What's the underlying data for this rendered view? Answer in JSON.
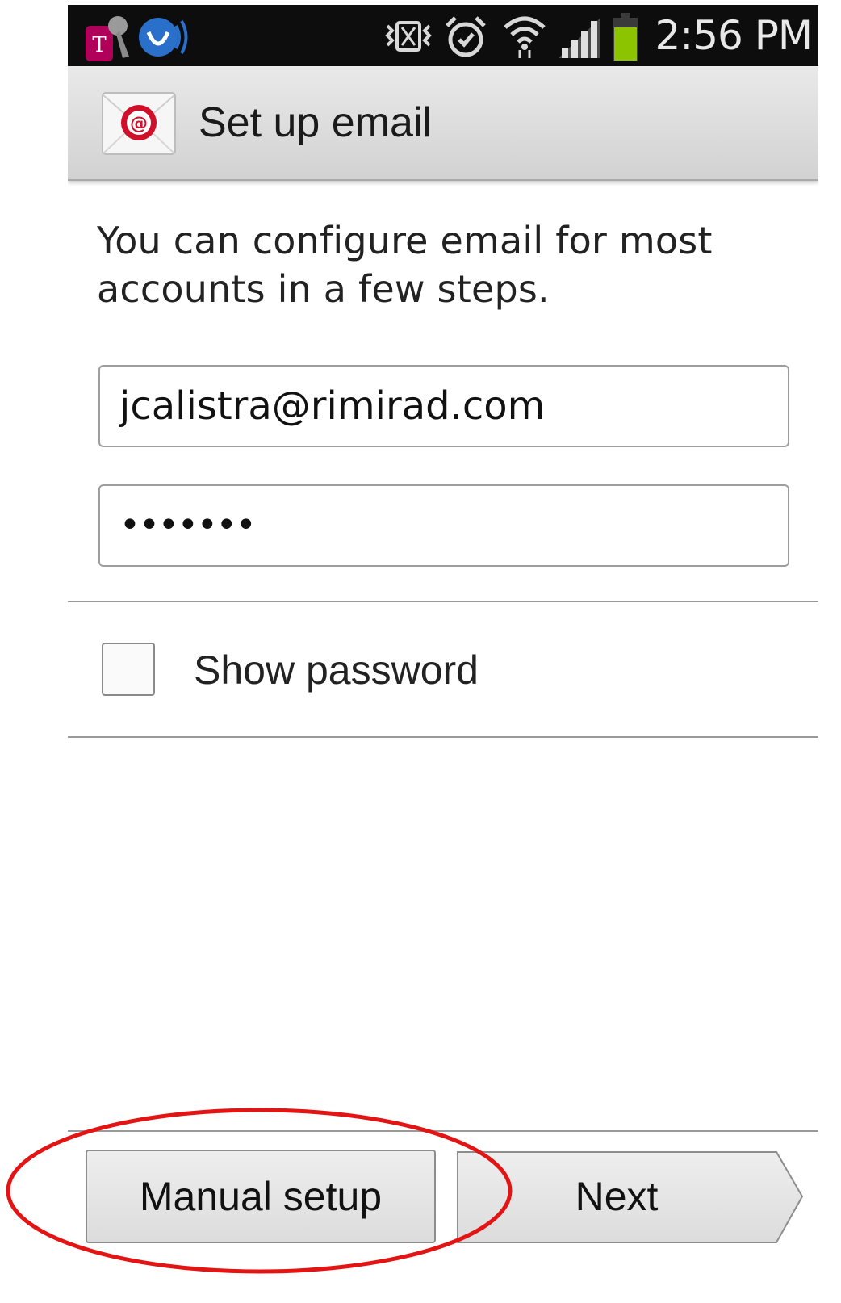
{
  "status_bar": {
    "time": "2:56 PM",
    "icons": [
      "t-mobile-app-icon",
      "voicemail-icon",
      "vibrate-icon",
      "alarm-icon",
      "wifi-icon",
      "signal-icon",
      "battery-icon"
    ]
  },
  "action_bar": {
    "title": "Set up email",
    "icon": "email-app-icon"
  },
  "main": {
    "intro": "You can configure email for most accounts in a few steps.",
    "email_value": "jcalistra@rimirad.com",
    "password_value": "•••••••",
    "show_password_label": "Show password",
    "show_password_checked": false
  },
  "buttons": {
    "manual_setup": "Manual setup",
    "next": "Next"
  },
  "colors": {
    "annotation_ellipse": "#e31414",
    "battery": "#8cc400",
    "t_mobile": "#b0005a"
  }
}
